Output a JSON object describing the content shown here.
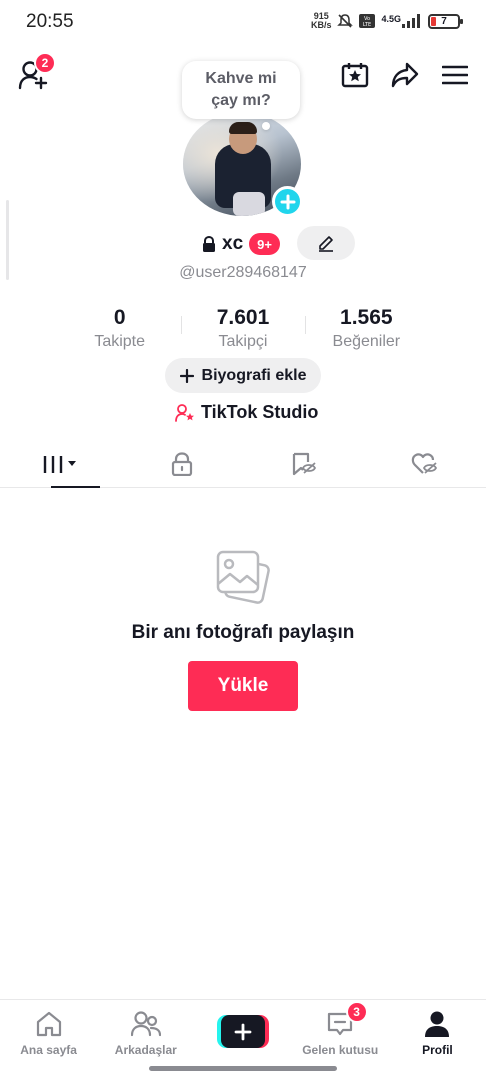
{
  "status_bar": {
    "time": "20:55",
    "net_speed_value": "915",
    "net_speed_unit": "KB/s",
    "network": "4.5G",
    "battery": "7"
  },
  "top_nav": {
    "add_friend_badge": "2",
    "icons": [
      "add-friend-icon",
      "calendar-star-icon",
      "share-icon",
      "menu-icon"
    ]
  },
  "profile": {
    "note_bubble": "Kahve mi çay mı?",
    "display_name": "xc",
    "name_badge": "9+",
    "handle": "@user289468147"
  },
  "stats": [
    {
      "value": "0",
      "label": "Takipte"
    },
    {
      "value": "7.601",
      "label": "Takipçi"
    },
    {
      "value": "1.565",
      "label": "Beğeniler"
    }
  ],
  "actions": {
    "bio_button": "Biyografi ekle",
    "studio_link": "TikTok Studio"
  },
  "tabs": [
    "videos-grid-icon",
    "lock-icon",
    "bookmark-hidden-icon",
    "heart-hidden-icon"
  ],
  "empty_state": {
    "title": "Bir anı fotoğrafı paylaşın",
    "button": "Yükle"
  },
  "bottom_nav": {
    "items": [
      {
        "label": "Ana sayfa"
      },
      {
        "label": "Arkadaşlar"
      },
      {
        "label": ""
      },
      {
        "label": "Gelen kutusu"
      },
      {
        "label": "Profil"
      }
    ],
    "inbox_badge": "3"
  },
  "colors": {
    "accent": "#fe2c55",
    "cyan": "#20d5ec"
  }
}
